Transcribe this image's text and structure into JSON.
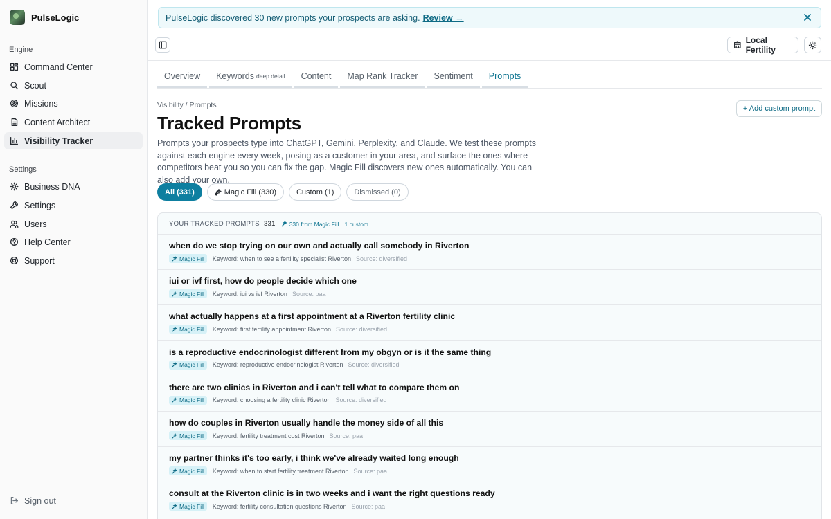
{
  "sidebar": {
    "brand": "PulseLogic",
    "section_engine": "Engine",
    "section_settings": "Settings",
    "engine_items": [
      {
        "label": "Command Center",
        "icon": "grid-icon"
      },
      {
        "label": "Scout",
        "icon": "search-icon"
      },
      {
        "label": "Missions",
        "icon": "target-icon"
      },
      {
        "label": "Content Architect",
        "icon": "document-icon"
      },
      {
        "label": "Visibility Tracker",
        "icon": "bar-chart-icon",
        "active": true
      }
    ],
    "settings_items": [
      {
        "label": "Business DNA",
        "icon": "gear-icon"
      },
      {
        "label": "Settings",
        "icon": "wrench-icon"
      },
      {
        "label": "Users",
        "icon": "users-icon"
      },
      {
        "label": "Help Center",
        "icon": "help-circle-icon"
      },
      {
        "label": "Support",
        "icon": "lifebuoy-icon"
      }
    ],
    "sign_out": "Sign out"
  },
  "banner": {
    "text": "PulseLogic discovered 30 new prompts your prospects are asking.",
    "link": "Review →"
  },
  "topbar": {
    "location": "Local Fertility"
  },
  "tabs": [
    {
      "label": "Overview",
      "sub": ""
    },
    {
      "label": "Keywords",
      "sub": "deep detail"
    },
    {
      "label": "Content",
      "sub": ""
    },
    {
      "label": "Map Rank Tracker",
      "sub": ""
    },
    {
      "label": "Sentiment",
      "sub": ""
    },
    {
      "label": "Prompts",
      "sub": "",
      "active": true
    }
  ],
  "header": {
    "breadcrumb": "Visibility / Prompts",
    "title": "Tracked Prompts",
    "description": "Prompts your prospects type into ChatGPT, Gemini, Perplexity, and Claude. We test these prompts against each engine every week, posing as a customer in your area, and surface the ones where competitors beat you so you can fix the gap. Magic Fill discovers new ones automatically. You can also add your own.",
    "add_button": "+ Add custom prompt"
  },
  "filters": [
    {
      "label": "All (331)",
      "active": true
    },
    {
      "label": "Magic Fill (330)",
      "icon": true
    },
    {
      "label": "Custom (1)"
    },
    {
      "label": "Dismissed (0)"
    }
  ],
  "card": {
    "title": "YOUR TRACKED PROMPTS",
    "count": "331",
    "magic_fill": "330 from Magic Fill",
    "custom": "1 custom",
    "badge_label": "Magic Fill",
    "rows": [
      {
        "q": "when do we stop trying on our own and actually call somebody in Riverton",
        "kw": "Keyword: when to see a fertility specialist Riverton",
        "src": "Source: diversified"
      },
      {
        "q": "iui or ivf first, how do people decide which one",
        "kw": "Keyword: iui vs ivf Riverton",
        "src": "Source: paa"
      },
      {
        "q": "what actually happens at a first appointment at a Riverton fertility clinic",
        "kw": "Keyword: first fertility appointment Riverton",
        "src": "Source: diversified"
      },
      {
        "q": "is a reproductive endocrinologist different from my obgyn or is it the same thing",
        "kw": "Keyword: reproductive endocrinologist Riverton",
        "src": "Source: diversified"
      },
      {
        "q": "there are two clinics in Riverton and i can't tell what to compare them on",
        "kw": "Keyword: choosing a fertility clinic Riverton",
        "src": "Source: diversified"
      },
      {
        "q": "how do couples in Riverton usually handle the money side of all this",
        "kw": "Keyword: fertility treatment cost Riverton",
        "src": "Source: paa"
      },
      {
        "q": "my partner thinks it's too early, i think we've already waited long enough",
        "kw": "Keyword: when to start fertility treatment Riverton",
        "src": "Source: paa"
      },
      {
        "q": "consult at the Riverton clinic is in two weeks and i want the right questions ready",
        "kw": "Keyword: fertility consultation questions Riverton",
        "src": "Source: paa"
      }
    ]
  }
}
